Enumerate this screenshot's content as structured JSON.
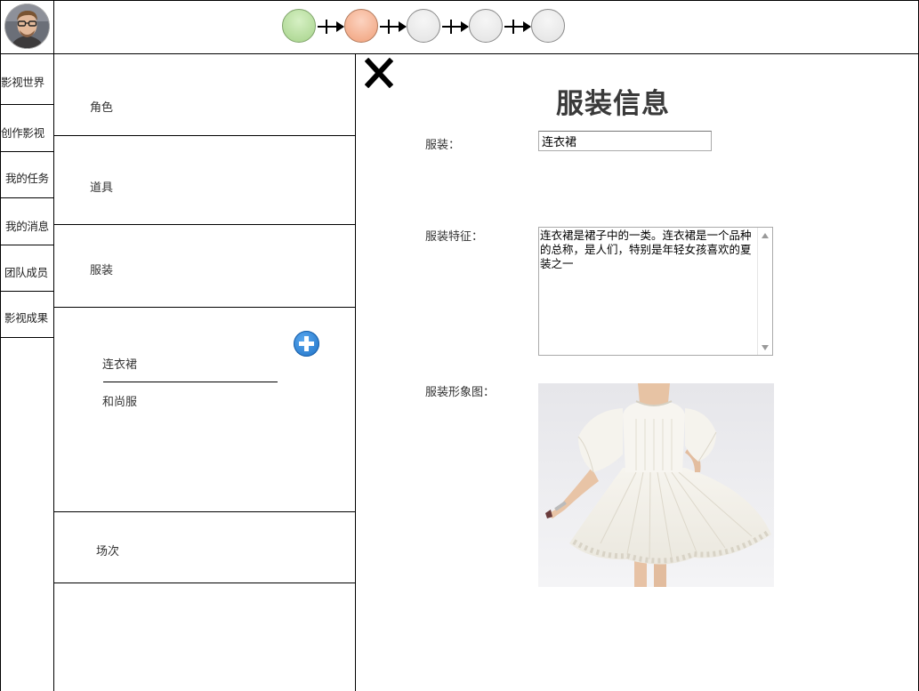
{
  "nav": {
    "items": [
      {
        "label": "影视世界"
      },
      {
        "label": "创作影视"
      },
      {
        "label": "我的任务"
      },
      {
        "label": "我的消息"
      },
      {
        "label": "团队成员"
      },
      {
        "label": "影视成果"
      }
    ]
  },
  "progress": {
    "steps": [
      {
        "state": "done",
        "color": "#a6d38a"
      },
      {
        "state": "current",
        "color": "#f0a07a"
      },
      {
        "state": "pending",
        "color": "#e6e6e6"
      },
      {
        "state": "pending",
        "color": "#e6e6e6"
      },
      {
        "state": "pending",
        "color": "#e6e6e6"
      }
    ]
  },
  "categories": {
    "role": "角色",
    "props": "道具",
    "costume": "服装",
    "scene": "场次"
  },
  "costume_list": {
    "items": [
      "连衣裙",
      "和尚服"
    ]
  },
  "detail": {
    "title": "服装信息",
    "costume_label": "服装：",
    "costume_value": "连衣裙",
    "feature_label": "服装特征：",
    "feature_value": "连衣裙是裙子中的一类。连衣裙是一个品种的总称，是人们，特别是年轻女孩喜欢的夏装之一",
    "image_label": "服装形象图："
  },
  "icons": {
    "close": "close-icon",
    "add": "plus-circle-icon",
    "avatar": "user-avatar"
  },
  "colors": {
    "step_done": "#a6d38a",
    "step_current": "#f0a07a",
    "add_button": "#1b6fc4"
  }
}
